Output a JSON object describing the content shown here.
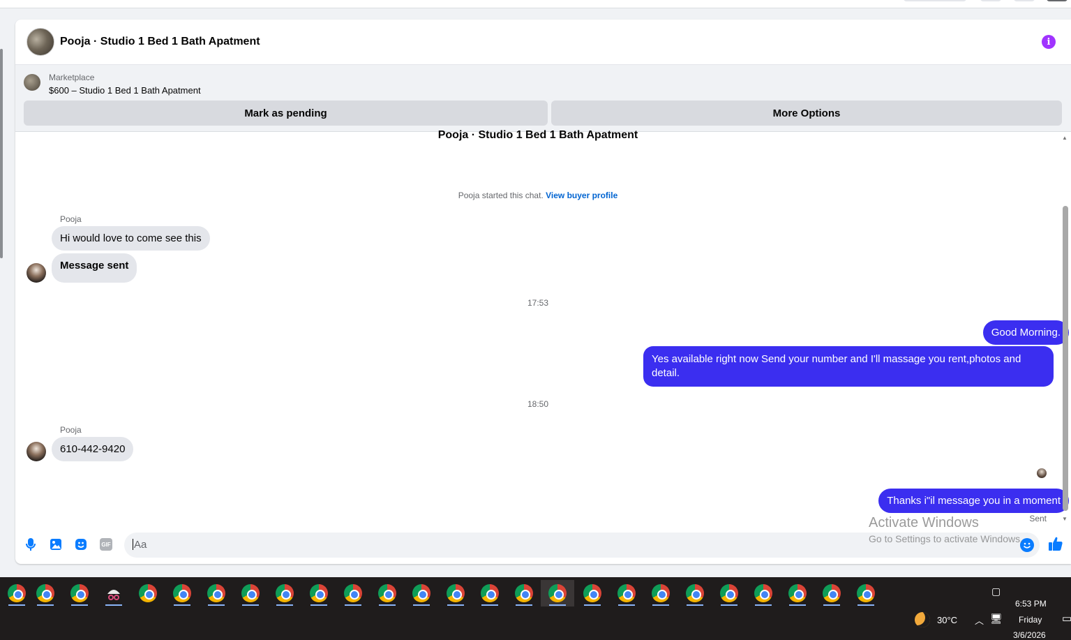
{
  "chat": {
    "title": "Pooja · Studio 1 Bed 1 Bath Apatment",
    "info_icon": "info-icon",
    "accent_color": "#a033ff"
  },
  "marketplace": {
    "label": "Marketplace",
    "listing": "$600 – Studio 1 Bed 1 Bath Apatment",
    "pending_button": "Mark as pending",
    "more_options_button": "More Options"
  },
  "conversation": {
    "title": "Pooja · Studio 1 Bed 1 Bath Apatment",
    "started_text": "Pooja started this chat.",
    "buyer_profile_link": "View buyer profile"
  },
  "messages": [
    {
      "sender": "Pooja",
      "direction": "in",
      "text": "Hi would love to come see this"
    },
    {
      "direction": "in",
      "text": "Message sent",
      "bold": true
    },
    {
      "type": "timestamp",
      "text": "17:53"
    },
    {
      "direction": "out",
      "text": "Good Morning."
    },
    {
      "direction": "out",
      "text": "Yes available right now Send your number and I'll massage you rent,photos and detail."
    },
    {
      "type": "timestamp",
      "text": "18:50"
    },
    {
      "sender": "Pooja",
      "direction": "in",
      "text": "610-442-9420"
    },
    {
      "direction": "out",
      "text": "Thanks i\"il message you in a moment",
      "status": "Sent"
    }
  ],
  "composer": {
    "placeholder": "Aa",
    "icons": [
      "microphone-icon",
      "image-icon",
      "sticker-icon",
      "gif-icon",
      "emoji-icon",
      "thumbs-up-icon"
    ],
    "gif_label": "GIF"
  },
  "watermark": {
    "line1": "Activate Windows",
    "line2": "Go to Settings to activate Windows."
  },
  "taskbar": {
    "app_icons": "chrome-icon",
    "weather": "30°C",
    "time": "6:53 PM",
    "day": "Friday",
    "date": "3/6/2026"
  },
  "colors": {
    "outgoing_bubble": "#3b2ef0",
    "incoming_bubble": "#e4e6eb",
    "link": "#0064d1",
    "messenger_blue": "#0a7cff"
  }
}
